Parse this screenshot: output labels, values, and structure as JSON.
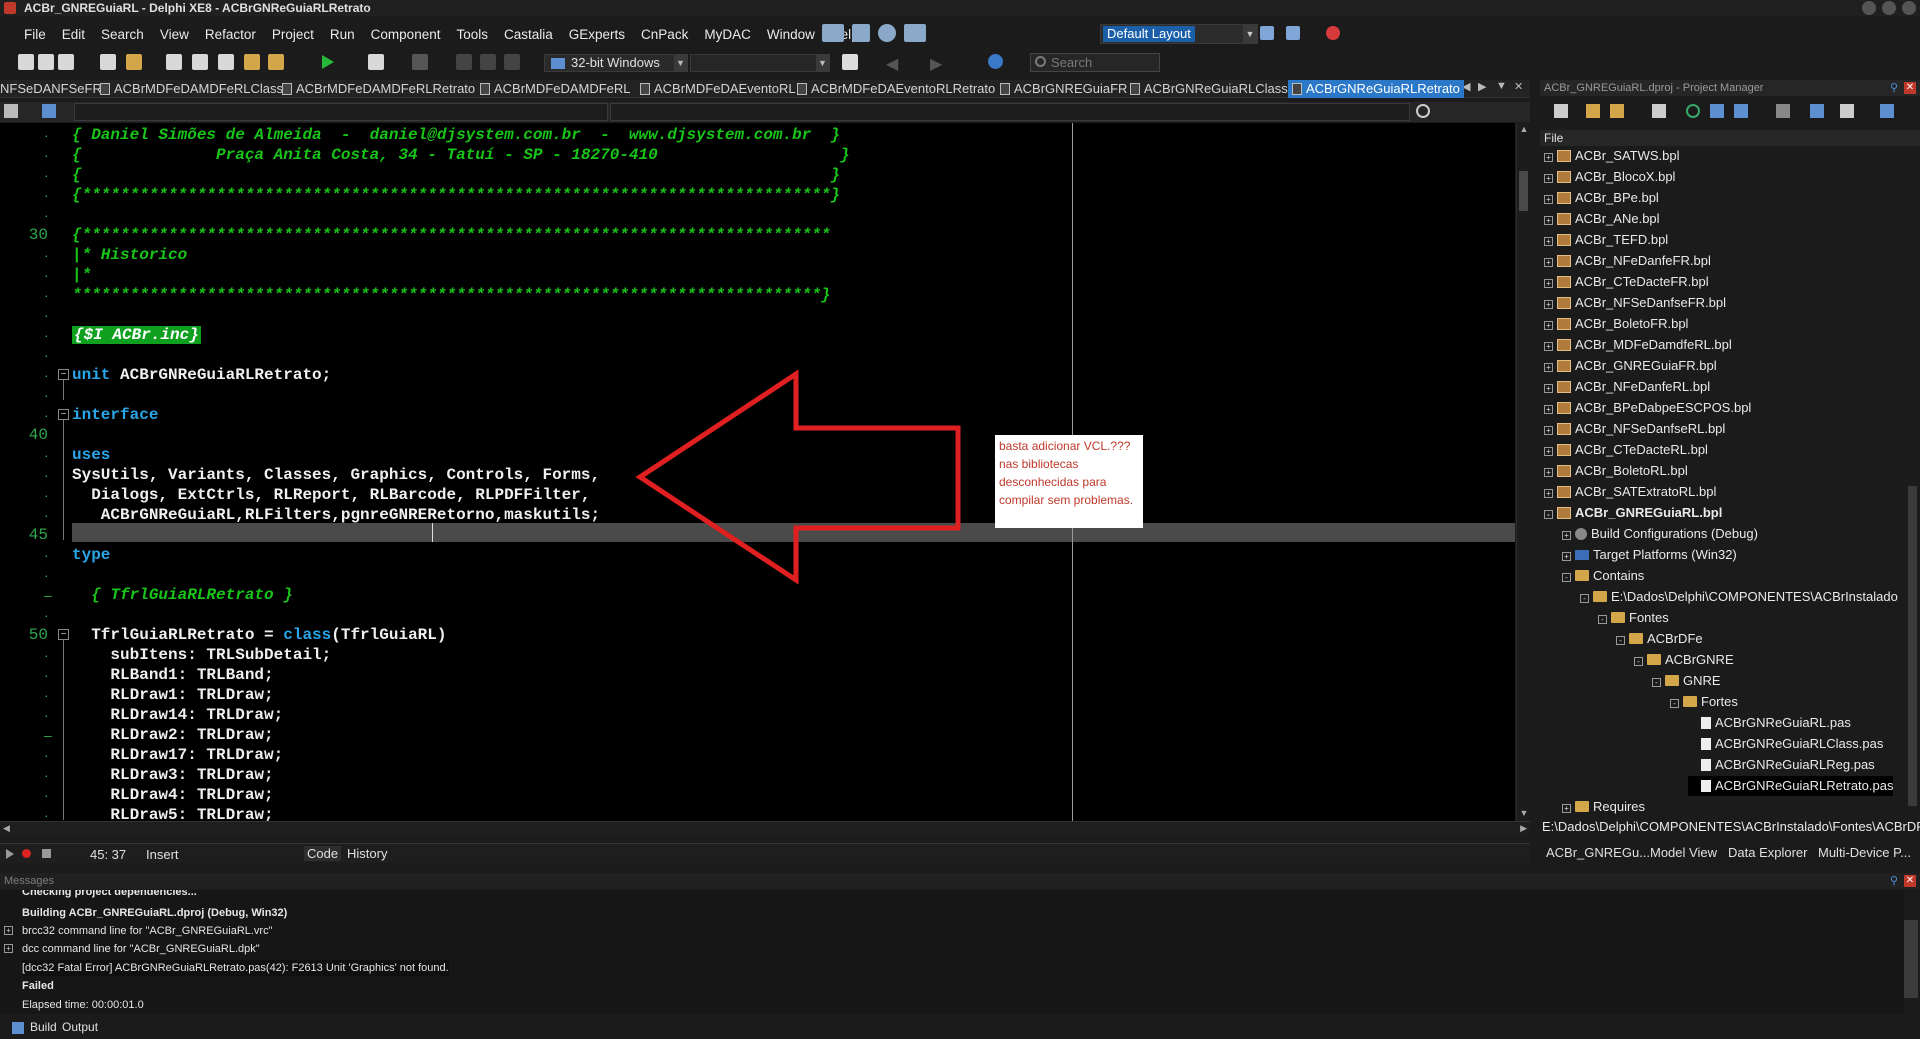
{
  "window": {
    "title": "ACBr_GNREGuiaRL - Delphi XE8 - ACBrGNReGuiaRLRetrato"
  },
  "menu": [
    "File",
    "Edit",
    "Search",
    "View",
    "Refactor",
    "Project",
    "Run",
    "Component",
    "Tools",
    "Castalia",
    "GExperts",
    "CnPack",
    "MyDAC",
    "Window",
    "Help"
  ],
  "toolbar": {
    "layout_value": "Default Layout",
    "platform_value": "32-bit Windows",
    "search_placeholder": "Search"
  },
  "file_tabs": [
    "NFSeDANFSeFR",
    "ACBrMDFeDAMDFeRLClass",
    "ACBrMDFeDAMDFeRLRetrato",
    "ACBrMDFeDAMDFeRL",
    "ACBrMDFeDAEventoRL",
    "ACBrMDFeDAEventoRLRetrato",
    "ACBrGNREGuiaFR",
    "ACBrGNReGuiaRLClass",
    "ACBrGNReGuiaRLRetrato"
  ],
  "active_file_tab": "ACBrGNReGuiaRLRetrato",
  "editor": {
    "line_numbers": [
      "30",
      "40",
      "45",
      "50"
    ],
    "lines": [
      {
        "text": "{ Daniel Simões de Almeida  -  daniel@djsystem.com.br  -  www.djsystem.com.br  }"
      },
      {
        "text": "{              Praça Anita Costa, 34 - Tatuí - SP - 18270-410                   }"
      },
      {
        "text": "{                                                                              }"
      },
      {
        "text": "{******************************************************************************}"
      },
      {
        "text": ""
      },
      {
        "text": "{******************************************************************************"
      },
      {
        "text": "|* Historico"
      },
      {
        "text": "|*"
      },
      {
        "text": "******************************************************************************}"
      },
      {
        "text": ""
      },
      {
        "text": "{$I ACBr.inc}"
      },
      {
        "text": ""
      },
      {
        "kw": "unit",
        "text": " ACBrGNReGuiaRLRetrato;"
      },
      {
        "text": ""
      },
      {
        "kw": "interface",
        "text": ""
      },
      {
        "text": ""
      },
      {
        "kw": "uses",
        "text": ""
      },
      {
        "text": "SysUtils, Variants, Classes, Graphics, Controls, Forms,"
      },
      {
        "text": "  Dialogs, ExtCtrls, RLReport, RLBarcode, RLPDFFilter,"
      },
      {
        "text": "   ACBrGNReGuiaRL,RLFilters,pgnreGNRERetorno,maskutils;"
      },
      {
        "text": ""
      },
      {
        "kw": "type",
        "text": ""
      },
      {
        "text": ""
      },
      {
        "text": "  { TfrlGuiaRLRetrato }"
      },
      {
        "text": ""
      },
      {
        "text": "  TfrlGuiaRLRetrato = ",
        "kw2": "class",
        "text2": "(TfrlGuiaRL)"
      },
      {
        "text": "    subItens: TRLSubDetail;"
      },
      {
        "text": "    RLBand1: TRLBand;"
      },
      {
        "text": "    RLDraw1: TRLDraw;"
      },
      {
        "text": "    RLDraw14: TRLDraw;"
      },
      {
        "text": "    RLDraw2: TRLDraw;"
      },
      {
        "text": "    RLDraw17: TRLDraw;"
      },
      {
        "text": "    RLDraw3: TRLDraw;"
      },
      {
        "text": "    RLDraw4: TRLDraw;"
      },
      {
        "text": "    RLDraw5: TRLDraw;"
      }
    ]
  },
  "annotation_note": "basta adicionar VCL.??? nas bibliotecas desconhecidas para compilar sem problemas.",
  "status": {
    "position": "45: 37",
    "mode": "Insert",
    "view_tabs": [
      "Code",
      "History"
    ]
  },
  "project_manager": {
    "title": "ACBr_GNREGuiaRL.dproj - Project Manager",
    "file_header": "File",
    "tree": [
      {
        "label": "ACBr_SATWS.bpl",
        "level": 0,
        "icon": "package",
        "exp": "+"
      },
      {
        "label": "ACBr_BlocoX.bpl",
        "level": 0,
        "icon": "package",
        "exp": "+"
      },
      {
        "label": "ACBr_BPe.bpl",
        "level": 0,
        "icon": "package",
        "exp": "+"
      },
      {
        "label": "ACBr_ANe.bpl",
        "level": 0,
        "icon": "package",
        "exp": "+"
      },
      {
        "label": "ACBr_TEFD.bpl",
        "level": 0,
        "icon": "package",
        "exp": "+"
      },
      {
        "label": "ACBr_NFeDanfeFR.bpl",
        "level": 0,
        "icon": "package",
        "exp": "+"
      },
      {
        "label": "ACBr_CTeDacteFR.bpl",
        "level": 0,
        "icon": "package",
        "exp": "+"
      },
      {
        "label": "ACBr_NFSeDanfseFR.bpl",
        "level": 0,
        "icon": "package",
        "exp": "+"
      },
      {
        "label": "ACBr_BoletoFR.bpl",
        "level": 0,
        "icon": "package",
        "exp": "+"
      },
      {
        "label": "ACBr_MDFeDamdfeRL.bpl",
        "level": 0,
        "icon": "package",
        "exp": "+"
      },
      {
        "label": "ACBr_GNREGuiaFR.bpl",
        "level": 0,
        "icon": "package",
        "exp": "+"
      },
      {
        "label": "ACBr_NFeDanfeRL.bpl",
        "level": 0,
        "icon": "package",
        "exp": "+"
      },
      {
        "label": "ACBr_BPeDabpeESCPOS.bpl",
        "level": 0,
        "icon": "package",
        "exp": "+"
      },
      {
        "label": "ACBr_NFSeDanfseRL.bpl",
        "level": 0,
        "icon": "package",
        "exp": "+"
      },
      {
        "label": "ACBr_CTeDacteRL.bpl",
        "level": 0,
        "icon": "package",
        "exp": "+"
      },
      {
        "label": "ACBr_BoletoRL.bpl",
        "level": 0,
        "icon": "package",
        "exp": "+"
      },
      {
        "label": "ACBr_SATExtratoRL.bpl",
        "level": 0,
        "icon": "package",
        "exp": "+"
      },
      {
        "label": "ACBr_GNREGuiaRL.bpl",
        "level": 0,
        "icon": "package",
        "exp": "-",
        "bold": true
      },
      {
        "label": "Build Configurations (Debug)",
        "level": 1,
        "icon": "config",
        "exp": "+"
      },
      {
        "label": "Target Platforms (Win32)",
        "level": 1,
        "icon": "platform",
        "exp": "+"
      },
      {
        "label": "Contains",
        "level": 1,
        "icon": "folder",
        "exp": "-"
      },
      {
        "label": "E:\\Dados\\Delphi\\COMPONENTES\\ACBrInstalado",
        "level": 2,
        "icon": "folder",
        "exp": "-"
      },
      {
        "label": "Fontes",
        "level": 3,
        "icon": "folder",
        "exp": "-"
      },
      {
        "label": "ACBrDFe",
        "level": 4,
        "icon": "folder",
        "exp": "-"
      },
      {
        "label": "ACBrGNRE",
        "level": 5,
        "icon": "folder",
        "exp": "-"
      },
      {
        "label": "GNRE",
        "level": 6,
        "icon": "folder",
        "exp": "-"
      },
      {
        "label": "Fortes",
        "level": 7,
        "icon": "folder",
        "exp": "-"
      },
      {
        "label": "ACBrGNReGuiaRL.pas",
        "level": 8,
        "icon": "file",
        "exp": ""
      },
      {
        "label": "ACBrGNReGuiaRLClass.pas",
        "level": 8,
        "icon": "file",
        "exp": ""
      },
      {
        "label": "ACBrGNReGuiaRLReg.pas",
        "level": 8,
        "icon": "file",
        "exp": ""
      },
      {
        "label": "ACBrGNReGuiaRLRetrato.pas",
        "level": 8,
        "icon": "file",
        "exp": "",
        "selected": true
      },
      {
        "label": "Requires",
        "level": 1,
        "icon": "folder",
        "exp": "+"
      }
    ],
    "path": "E:\\Dados\\Delphi\\COMPONENTES\\ACBrInstalado\\Fontes\\ACBrDFe\\",
    "tabs": [
      "ACBr_GNREGu...",
      "Model View",
      "Data Explorer",
      "Multi-Device P..."
    ]
  },
  "messages": {
    "title": "Messages",
    "lines": [
      {
        "text": "Checking project dependencies...",
        "bold": true,
        "exp": ""
      },
      {
        "text": "Building ACBr_GNREGuiaRL.dproj (Debug, Win32)",
        "bold": true,
        "exp": ""
      },
      {
        "text": "brcc32 command line for \"ACBr_GNREGuiaRL.vrc\"",
        "bold": false,
        "exp": "+"
      },
      {
        "text": "dcc command line for \"ACBr_GNREGuiaRL.dpk\"",
        "bold": false,
        "exp": "+"
      },
      {
        "text": "[dcc32 Fatal Error] ACBrGNReGuiaRLRetrato.pas(42): F2613 Unit 'Graphics' not found.",
        "bold": false,
        "exp": ""
      },
      {
        "text": "Failed",
        "bold": true,
        "exp": ""
      },
      {
        "text": "Elapsed time: 00:00:01.0",
        "bold": false,
        "exp": ""
      }
    ],
    "tabs": [
      "Build",
      "Output"
    ]
  }
}
